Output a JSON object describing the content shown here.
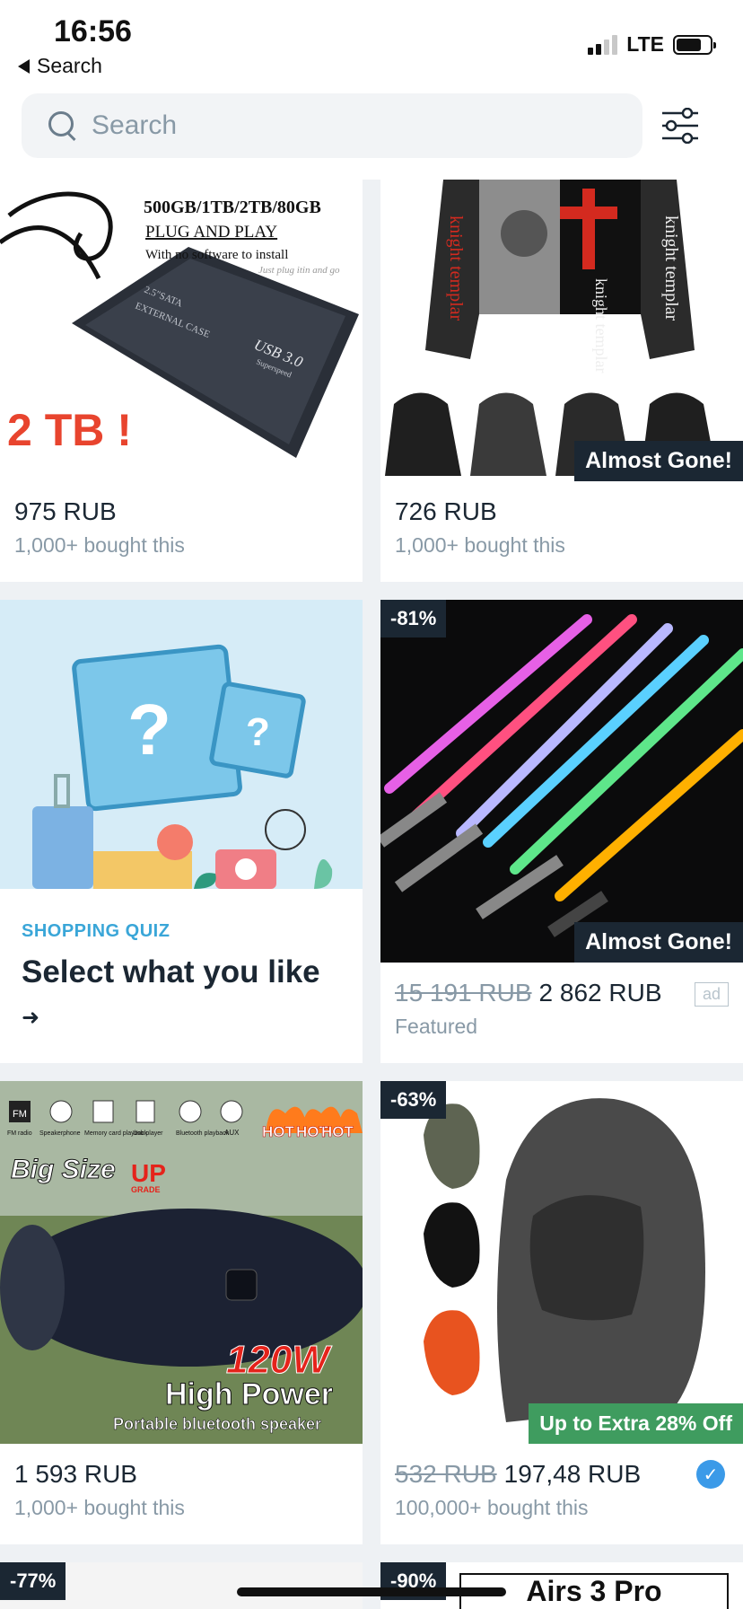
{
  "status_bar": {
    "time": "16:56",
    "back_label": "Search",
    "network": "LTE",
    "battery_level": 0.75
  },
  "search": {
    "placeholder": "Search",
    "value": ""
  },
  "products": [
    {
      "price": "975 RUB",
      "sub_text": "1,000+ bought this",
      "image_text": [
        "500GB/1TB/2TB/80GB",
        "PLUG AND PLAY",
        "With no software to install",
        "Just plug itin and go",
        "2.5\"SATA",
        "EXTERNAL CASE",
        "USB 3.0",
        "Superspeed",
        "2 TB !"
      ]
    },
    {
      "price": "726 RUB",
      "sub_text": "1,000+ bought this",
      "badge": "Almost Gone!",
      "image_text": [
        "knight templar",
        "knight templar",
        "knight templar"
      ]
    },
    {
      "discount": "-81%",
      "old_price": "15 191 RUB",
      "price": "2 862 RUB",
      "sub_text": "Featured",
      "badge": "Almost Gone!",
      "ad_label": "ad"
    },
    {
      "price": "1 593 RUB",
      "sub_text": "1,000+ bought this",
      "image_text": [
        "FM",
        "FM radio",
        "Speakerphone",
        "Memory card playback",
        "Usb player",
        "Bluetooth playback",
        "AUX",
        "HOT",
        "HOT",
        "HOT",
        "Big Size",
        "UP",
        "GRADE",
        "120W",
        "High Power",
        "Portable bluetooth speaker"
      ]
    },
    {
      "discount": "-63%",
      "old_price": "532 RUB",
      "price": "197,48 RUB",
      "sub_text": "100,000+ bought this",
      "badge": "Up to Extra 28% Off",
      "verified": "✓"
    },
    {
      "discount": "-77%"
    },
    {
      "discount": "-90%",
      "image_text": [
        "Airs 3 Pro"
      ]
    }
  ],
  "quiz": {
    "label": "SHOPPING QUIZ",
    "title": "Select what you like",
    "arrow": "➜"
  },
  "icons": {
    "back": "back-arrow-icon",
    "search": "search-icon",
    "filter": "filter-sliders-icon"
  },
  "colors": {
    "accent": "#3aa6d8",
    "badge_dark": "#1b2733",
    "badge_green": "#3f9c5f",
    "muted": "#8899a6"
  }
}
